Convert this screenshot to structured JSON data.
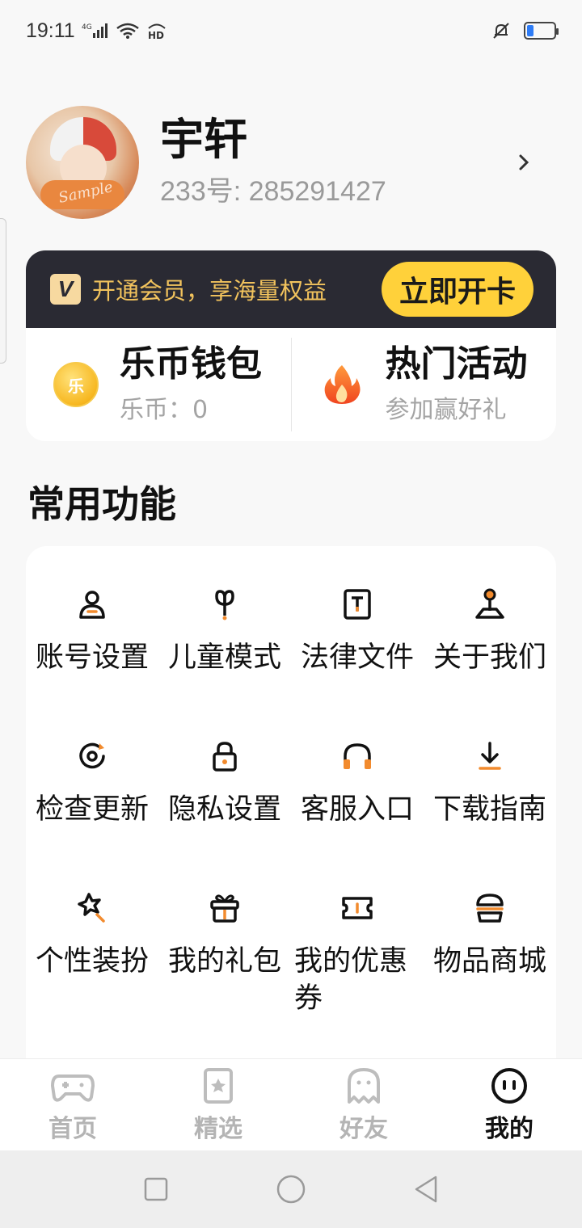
{
  "status_bar": {
    "time": "19:11",
    "network": "4G",
    "hd": "HD"
  },
  "profile": {
    "name": "宇轩",
    "id_text": "233号: 285291427",
    "avatar_watermark": "Sample"
  },
  "member": {
    "banner_text": "开通会员，享海量权益",
    "badge": "V",
    "open_card_label": "立即开卡",
    "wallet_title": "乐币钱包",
    "wallet_sub": "乐币：0",
    "coin_glyph": "乐",
    "activity_title": "热门活动",
    "activity_sub": "参加赢好礼"
  },
  "section_title": "常用功能",
  "features": [
    {
      "label": "账号设置",
      "icon": "user-icon"
    },
    {
      "label": "儿童模式",
      "icon": "sprout-icon"
    },
    {
      "label": "法律文件",
      "icon": "document-icon"
    },
    {
      "label": "关于我们",
      "icon": "joystick-icon"
    },
    {
      "label": "检查更新",
      "icon": "refresh-icon"
    },
    {
      "label": "隐私设置",
      "icon": "lock-icon"
    },
    {
      "label": "客服入口",
      "icon": "headset-icon"
    },
    {
      "label": "下载指南",
      "icon": "download-icon"
    },
    {
      "label": "个性装扮",
      "icon": "magic-wand-icon"
    },
    {
      "label": "我的礼包",
      "icon": "gift-icon"
    },
    {
      "label": "我的优惠券",
      "icon": "coupon-icon"
    },
    {
      "label": "物品商城",
      "icon": "store-icon"
    }
  ],
  "bottom_nav": [
    {
      "label": "首页",
      "icon": "gamepad-icon",
      "active": false
    },
    {
      "label": "精选",
      "icon": "star-card-icon",
      "active": false
    },
    {
      "label": "好友",
      "icon": "ghost-icon",
      "active": false
    },
    {
      "label": "我的",
      "icon": "face-icon",
      "active": true
    }
  ],
  "colors": {
    "accent": "#f28b2e",
    "gold": "#ffd13a",
    "banner_bg": "#2a2a33",
    "banner_text": "#f2c35d"
  }
}
